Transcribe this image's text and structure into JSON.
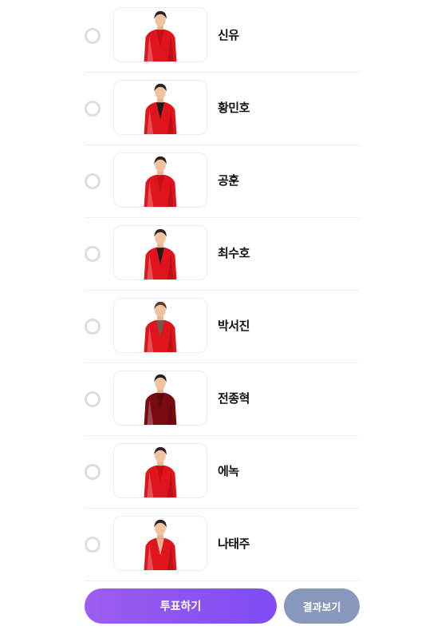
{
  "candidates": [
    {
      "name": "신유",
      "outfit": "red",
      "inner": "red",
      "hair": "dark"
    },
    {
      "name": "황민호",
      "outfit": "red",
      "inner": "black",
      "hair": "dark"
    },
    {
      "name": "공훈",
      "outfit": "red",
      "inner": "red",
      "hair": "dark"
    },
    {
      "name": "최수호",
      "outfit": "red",
      "inner": "black",
      "hair": "dark"
    },
    {
      "name": "박서진",
      "outfit": "red",
      "inner": "brown",
      "hair": "brown"
    },
    {
      "name": "전종혁",
      "outfit": "darkred",
      "inner": "darkred",
      "hair": "dark"
    },
    {
      "name": "에녹",
      "outfit": "red",
      "inner": "red",
      "hair": "dark"
    },
    {
      "name": "나태주",
      "outfit": "red",
      "inner": "skin",
      "hair": "dark"
    }
  ],
  "buttons": {
    "vote_label": "투표하기",
    "result_label": "결과보기"
  },
  "colors": {
    "vote_gradient_start": "#9d5df0",
    "vote_gradient_end": "#7e4cf2",
    "result_bg": "#8898bd",
    "radio_border": "#dcdde2"
  }
}
